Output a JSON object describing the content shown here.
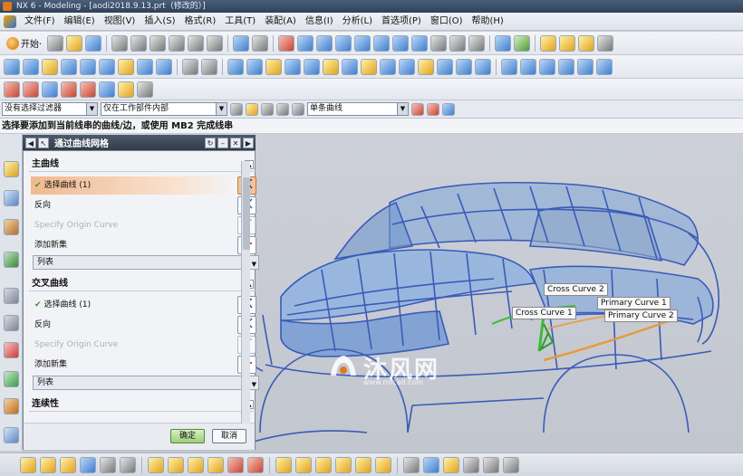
{
  "window": {
    "title": "NX 6 - Modeling - [aodi2018.9.13.prt（修改的）]"
  },
  "menu": [
    "文件(F)",
    "编辑(E)",
    "视图(V)",
    "插入(S)",
    "格式(R)",
    "工具(T)",
    "装配(A)",
    "信息(I)",
    "分析(L)",
    "首选项(P)",
    "窗口(O)",
    "帮助(H)"
  ],
  "toolbar": {
    "start_label": "开始·"
  },
  "selection_bar": {
    "filter": "没有选择过滤器",
    "scope": "仅在工作部件内部",
    "curve_rule": "单条曲线"
  },
  "cue_line": "选择要添加到当前线串的曲线/边，或使用 MB2 完成线串",
  "dialog": {
    "title": "通过曲线网格",
    "primary": {
      "header": "主曲线",
      "select_curve": "选择曲线 (1)",
      "reverse": "反向",
      "origin": "Specify Origin Curve",
      "add_set": "添加新集",
      "list": "列表"
    },
    "cross": {
      "header": "交叉曲线",
      "select_curve": "选择曲线 (1)",
      "reverse": "反向",
      "origin": "Specify Origin Curve",
      "add_set": "添加新集",
      "list": "列表"
    },
    "continuity_header": "连续性",
    "ok": "确定",
    "cancel": "取消"
  },
  "viewport": {
    "labels": {
      "cross2": "Cross Curve  2",
      "cross1": "Cross Curve  1",
      "primary1": "Primary Curve  1",
      "primary2": "Primary Curve  2"
    },
    "watermark": {
      "title": "沐风网",
      "url": "www.mfcad.com"
    }
  }
}
